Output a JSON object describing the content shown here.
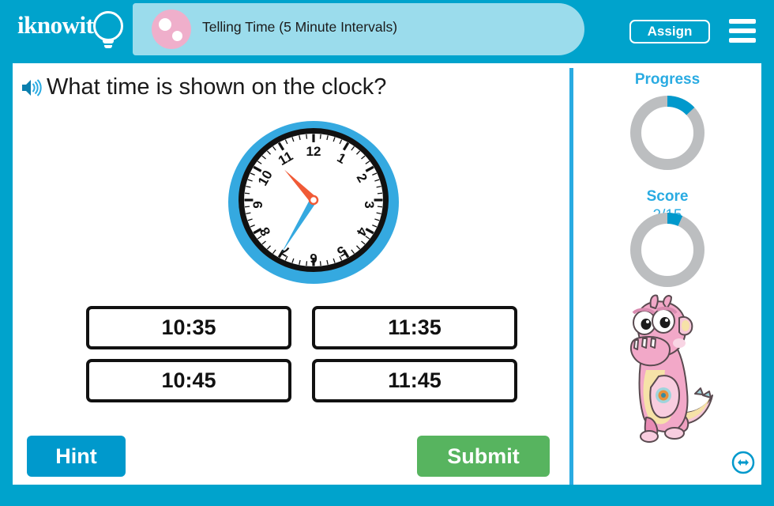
{
  "header": {
    "logo_text": "iknowit",
    "logo_icon": "lightbulb-icon",
    "title": "Telling Time (5 Minute Intervals)",
    "title_badge_icon": "pink-dots-icon",
    "assign_label": "Assign",
    "menu_icon": "hamburger-menu-icon",
    "bg_color": "#00A3CC",
    "banner_color": "#9BDCEC"
  },
  "question": {
    "audio_icon": "speaker-icon",
    "text": "What time is shown on the clock?"
  },
  "clock": {
    "displayed_time": "10:35",
    "hour_hand_value": 10.58,
    "minute_hand_value": 35,
    "hour_hand_color": "#F05A36",
    "minute_hand_color": "#35A9E0",
    "rim_color": "#35A9E0",
    "face_color": "#ffffff",
    "numerals": [
      "12",
      "1",
      "2",
      "3",
      "4",
      "5",
      "6",
      "7",
      "8",
      "9",
      "10",
      "11"
    ]
  },
  "answers": {
    "options": [
      {
        "label": "10:35"
      },
      {
        "label": "11:35"
      },
      {
        "label": "10:45"
      },
      {
        "label": "11:45"
      }
    ]
  },
  "actions": {
    "hint_label": "Hint",
    "hint_color": "#0099CC",
    "submit_label": "Submit",
    "submit_color": "#57B45F"
  },
  "sidebar": {
    "progress": {
      "label": "Progress",
      "value": "2/15",
      "percent": 13,
      "arc_color": "#0099CC",
      "track_color": "#BCBEC0"
    },
    "score": {
      "label": "Score",
      "value": "1",
      "percent": 6.7,
      "arc_color": "#0099CC",
      "track_color": "#BCBEC0"
    },
    "mascot_icon": "pink-monster-mascot",
    "resize_icon": "left-right-arrow-circle-icon"
  }
}
